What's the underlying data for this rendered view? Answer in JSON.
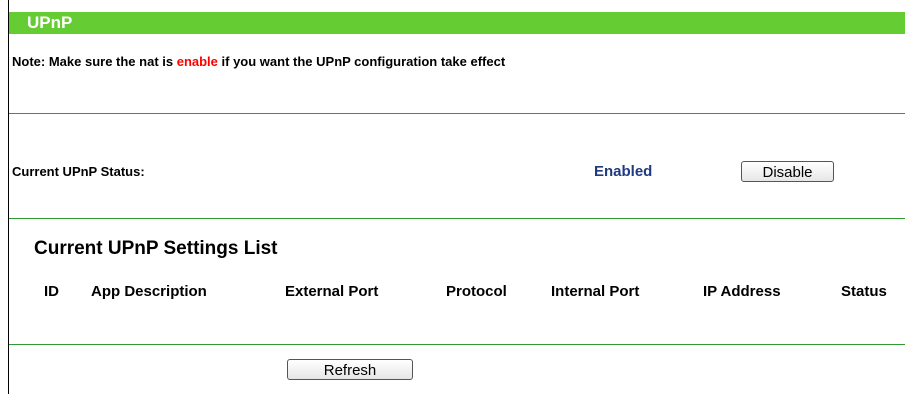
{
  "page": {
    "title": "UPnP"
  },
  "note": {
    "prefix": "Note:   Make sure the nat is ",
    "highlight": "enable",
    "suffix": " if you want the UPnP configuration take effect"
  },
  "status": {
    "label": "Current UPnP Status:",
    "value": "Enabled",
    "toggle_label": "Disable"
  },
  "settings_list": {
    "title": "Current UPnP Settings List",
    "columns": [
      "ID",
      "App Description",
      "External Port",
      "Protocol",
      "Internal Port",
      "IP Address",
      "Status"
    ],
    "rows": []
  },
  "actions": {
    "refresh_label": "Refresh"
  },
  "colors": {
    "title_bar": "#66cc33",
    "separator": "#339933",
    "note_highlight": "#ff0000",
    "status_value": "#1f3a80"
  }
}
